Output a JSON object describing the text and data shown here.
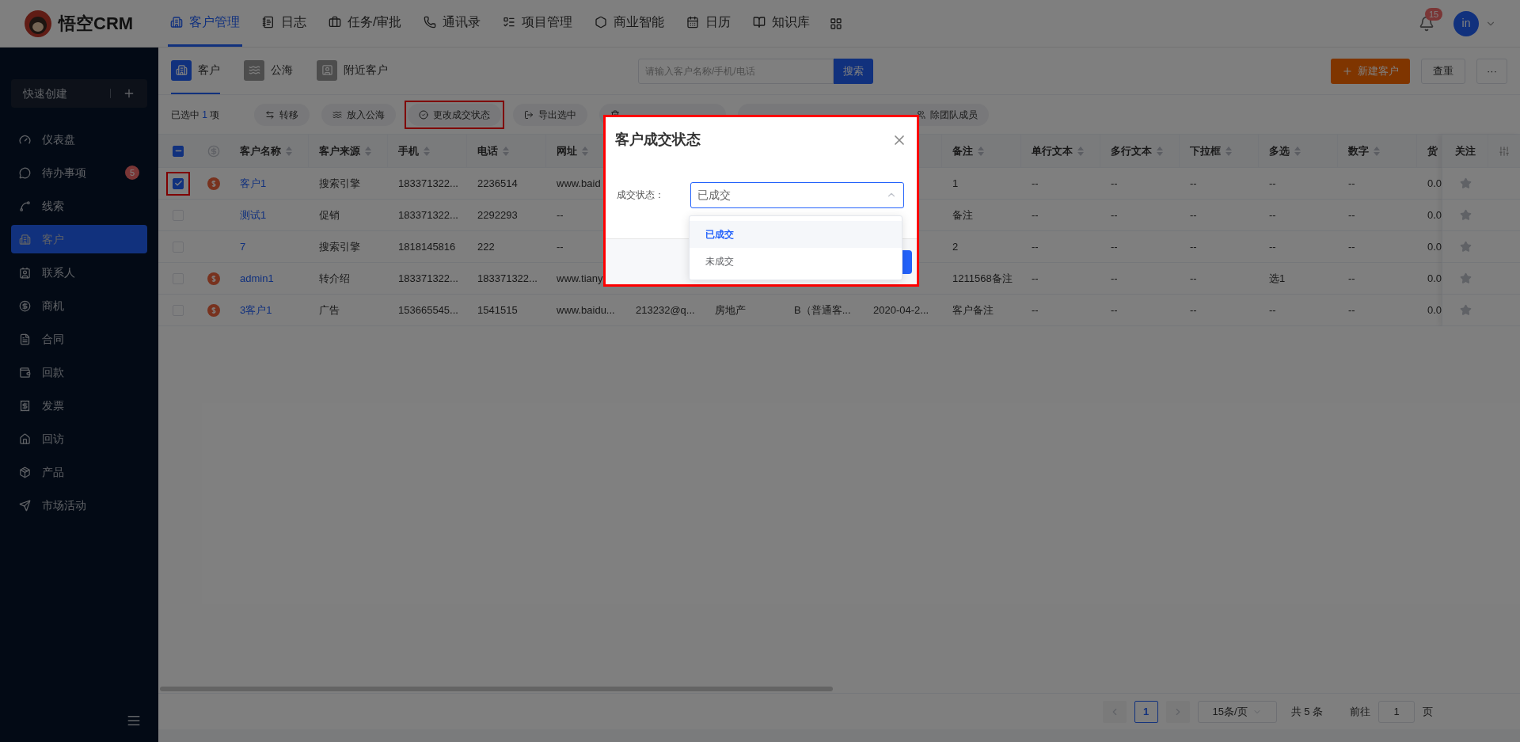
{
  "brand": {
    "name": "悟空CRM"
  },
  "top_nav": [
    {
      "label": "客户管理",
      "selected": true
    },
    {
      "label": "日志",
      "selected": false
    },
    {
      "label": "任务/审批",
      "selected": false
    },
    {
      "label": "通讯录",
      "selected": false
    },
    {
      "label": "项目管理",
      "selected": false
    },
    {
      "label": "商业智能",
      "selected": false
    },
    {
      "label": "日历",
      "selected": false
    },
    {
      "label": "知识库",
      "selected": false
    }
  ],
  "notifications": {
    "badge": "15"
  },
  "user": {
    "initials": "in"
  },
  "sidebar": {
    "quick_create": "快速创建",
    "items": [
      {
        "label": "仪表盘",
        "selected": false
      },
      {
        "label": "待办事项",
        "selected": false,
        "badge": "5"
      },
      {
        "label": "线索",
        "selected": false
      },
      {
        "label": "客户",
        "selected": true
      },
      {
        "label": "联系人",
        "selected": false
      },
      {
        "label": "商机",
        "selected": false
      },
      {
        "label": "合同",
        "selected": false
      },
      {
        "label": "回款",
        "selected": false
      },
      {
        "label": "发票",
        "selected": false
      },
      {
        "label": "回访",
        "selected": false
      },
      {
        "label": "产品",
        "selected": false
      },
      {
        "label": "市场活动",
        "selected": false
      }
    ]
  },
  "subtabs": [
    {
      "label": "客户",
      "selected": true
    },
    {
      "label": "公海",
      "selected": false
    },
    {
      "label": "附近客户",
      "selected": false
    }
  ],
  "search": {
    "placeholder": "请输入客户名称/手机/电话",
    "button": "搜索"
  },
  "actions": {
    "create": "新建客户",
    "dedupe": "查重",
    "more": "···"
  },
  "selection": {
    "prefix": "已选中",
    "count": "1",
    "suffix": "项"
  },
  "toolbar": [
    {
      "label": "转移",
      "highlighted": false
    },
    {
      "label": "放入公海",
      "highlighted": false
    },
    {
      "label": "更改成交状态",
      "highlighted": true
    },
    {
      "label": "导出选中",
      "highlighted": false
    },
    {
      "highlighted": false
    },
    {
      "label": "除团队成员",
      "highlighted": false
    }
  ],
  "table": {
    "indeterminate": true,
    "follow_header": "关注",
    "columns": [
      {
        "label": "客户名称",
        "sortable": true
      },
      {
        "label": "客户来源",
        "sortable": true
      },
      {
        "label": "手机",
        "sortable": true
      },
      {
        "label": "电话",
        "sortable": true
      },
      {
        "label": "网址",
        "sortable": true
      },
      null,
      null,
      null,
      null,
      {
        "label": "备注",
        "sortable": true
      },
      {
        "label": "单行文本",
        "sortable": true
      },
      {
        "label": "多行文本",
        "sortable": true
      },
      {
        "label": "下拉框",
        "sortable": true
      },
      {
        "label": "多选",
        "sortable": true
      },
      {
        "label": "数字",
        "sortable": true
      },
      {
        "label": "货",
        "sortable": false
      }
    ],
    "rows": [
      {
        "checked": true,
        "highlighted": true,
        "deal": true,
        "followed": false,
        "cells": [
          "客户1",
          "搜索引擎",
          "183371322...",
          "2236514",
          "www.baid",
          null,
          null,
          null,
          null,
          "1",
          "--",
          "--",
          "--",
          "--",
          "--",
          "0.0"
        ]
      },
      {
        "checked": false,
        "highlighted": false,
        "deal": false,
        "followed": false,
        "cells": [
          "测试1",
          "促销",
          "183371322...",
          "2292293",
          "--",
          null,
          null,
          null,
          null,
          "备注",
          "--",
          "--",
          "--",
          "--",
          "--",
          "0.0"
        ]
      },
      {
        "checked": false,
        "highlighted": false,
        "deal": false,
        "followed": false,
        "cells": [
          "7",
          "搜索引擎",
          "1818145816",
          "222",
          "--",
          null,
          null,
          null,
          null,
          "2",
          "--",
          "--",
          "--",
          "--",
          "--",
          "0.0"
        ]
      },
      {
        "checked": false,
        "highlighted": false,
        "deal": true,
        "followed": false,
        "cells": [
          "admin1",
          "转介绍",
          "183371322...",
          "183371322...",
          "www.tiany",
          null,
          null,
          null,
          null,
          "1211568备注",
          "--",
          "--",
          "--",
          "选1",
          "--",
          "0.0"
        ]
      },
      {
        "checked": false,
        "highlighted": false,
        "deal": true,
        "followed": false,
        "cells": [
          "3客户1",
          "广告",
          "153665545...",
          "1541515",
          "www.baidu...",
          "213232@q...",
          "房地产",
          "B（普通客...",
          "2020-04-2...",
          "客户备注",
          "--",
          "--",
          "--",
          "--",
          "--",
          "0.0"
        ]
      }
    ]
  },
  "pagination": {
    "page": "1",
    "page_size": "15条/页",
    "total": "共 5 条",
    "goto_label": "前往",
    "goto_value": "1",
    "goto_suffix": "页"
  },
  "modal": {
    "title": "客户成交状态",
    "highlighted": true,
    "field": {
      "label": "成交状态：",
      "value": "已成交",
      "open": true
    },
    "options": [
      {
        "label": "已成交",
        "selected": true
      },
      {
        "label": "未成交",
        "selected": false
      }
    ]
  }
}
